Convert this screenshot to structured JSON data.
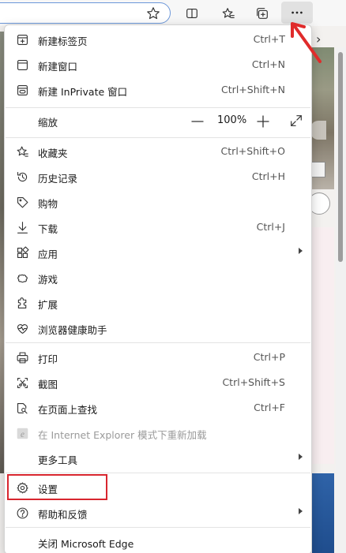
{
  "menu": {
    "new_tab": {
      "label": "新建标签页",
      "shortcut": "Ctrl+T"
    },
    "new_window": {
      "label": "新建窗口",
      "shortcut": "Ctrl+N"
    },
    "new_inprivate": {
      "label": "新建 InPrivate 窗口",
      "shortcut": "Ctrl+Shift+N"
    },
    "zoom": {
      "label": "缩放",
      "value": "100%"
    },
    "favorites": {
      "label": "收藏夹",
      "shortcut": "Ctrl+Shift+O"
    },
    "history": {
      "label": "历史记录",
      "shortcut": "Ctrl+H"
    },
    "shopping": {
      "label": "购物"
    },
    "downloads": {
      "label": "下载",
      "shortcut": "Ctrl+J"
    },
    "apps": {
      "label": "应用"
    },
    "games": {
      "label": "游戏"
    },
    "extensions": {
      "label": "扩展"
    },
    "browser_essentials": {
      "label": "浏览器健康助手"
    },
    "print": {
      "label": "打印",
      "shortcut": "Ctrl+P"
    },
    "screenshot": {
      "label": "截图",
      "shortcut": "Ctrl+Shift+S"
    },
    "find": {
      "label": "在页面上查找",
      "shortcut": "Ctrl+F"
    },
    "ie_mode": {
      "label": "在 Internet Explorer 模式下重新加载"
    },
    "more_tools": {
      "label": "更多工具"
    },
    "settings": {
      "label": "设置"
    },
    "help": {
      "label": "帮助和反馈"
    },
    "close_edge": {
      "label": "关闭 Microsoft Edge"
    }
  },
  "colors": {
    "highlight": "#d8262f",
    "address_border": "#6c97d9"
  }
}
